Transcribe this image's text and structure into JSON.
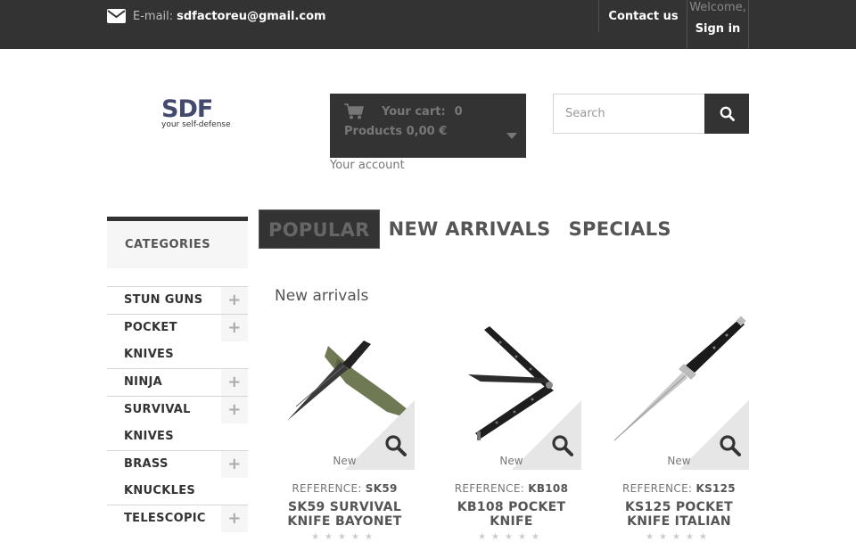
{
  "header": {
    "email_label": "E-mail:",
    "email": "sdfactoreu@gmail.com",
    "contact_label": "Contact us",
    "welcome_text": "Welcome,",
    "signin_label": "Sign in"
  },
  "logo": {
    "brand": "SDF",
    "tagline": "your self-defense"
  },
  "cart": {
    "label": "Your cart:",
    "count": "0",
    "products_text": "Products 0,00 €",
    "account_label": "Your account"
  },
  "search": {
    "placeholder": "Search"
  },
  "categories": {
    "title": "CATEGORIES",
    "items": [
      {
        "label": "STUN GUNS"
      },
      {
        "label": "POCKET KNIVES"
      },
      {
        "label": "NINJA"
      },
      {
        "label": "SURVIVAL KNIVES"
      },
      {
        "label": "BRASS KNUCKLES"
      },
      {
        "label": "TELESCOPIC"
      }
    ]
  },
  "tabs": [
    {
      "label": "POPULAR",
      "active": true
    },
    {
      "label": "NEW ARRIVALS",
      "active": false
    },
    {
      "label": "SPECIALS",
      "active": false
    }
  ],
  "section_title": "New arrivals",
  "products": [
    {
      "badge": "New",
      "ref_label": "REFERENCE:",
      "ref": "SK59",
      "name": "SK59 SURVIVAL KNIFE BAYONET"
    },
    {
      "badge": "New",
      "ref_label": "REFERENCE:",
      "ref": "KB108",
      "name": "KB108 POCKET KNIFE"
    },
    {
      "badge": "New",
      "ref_label": "REFERENCE:",
      "ref": "KS125",
      "name": "KS125 POCKET KNIFE ITALIAN"
    }
  ],
  "colors": {
    "topbar": "#333333",
    "accent_dark": "#333333",
    "panel": "#f6f6f6"
  }
}
